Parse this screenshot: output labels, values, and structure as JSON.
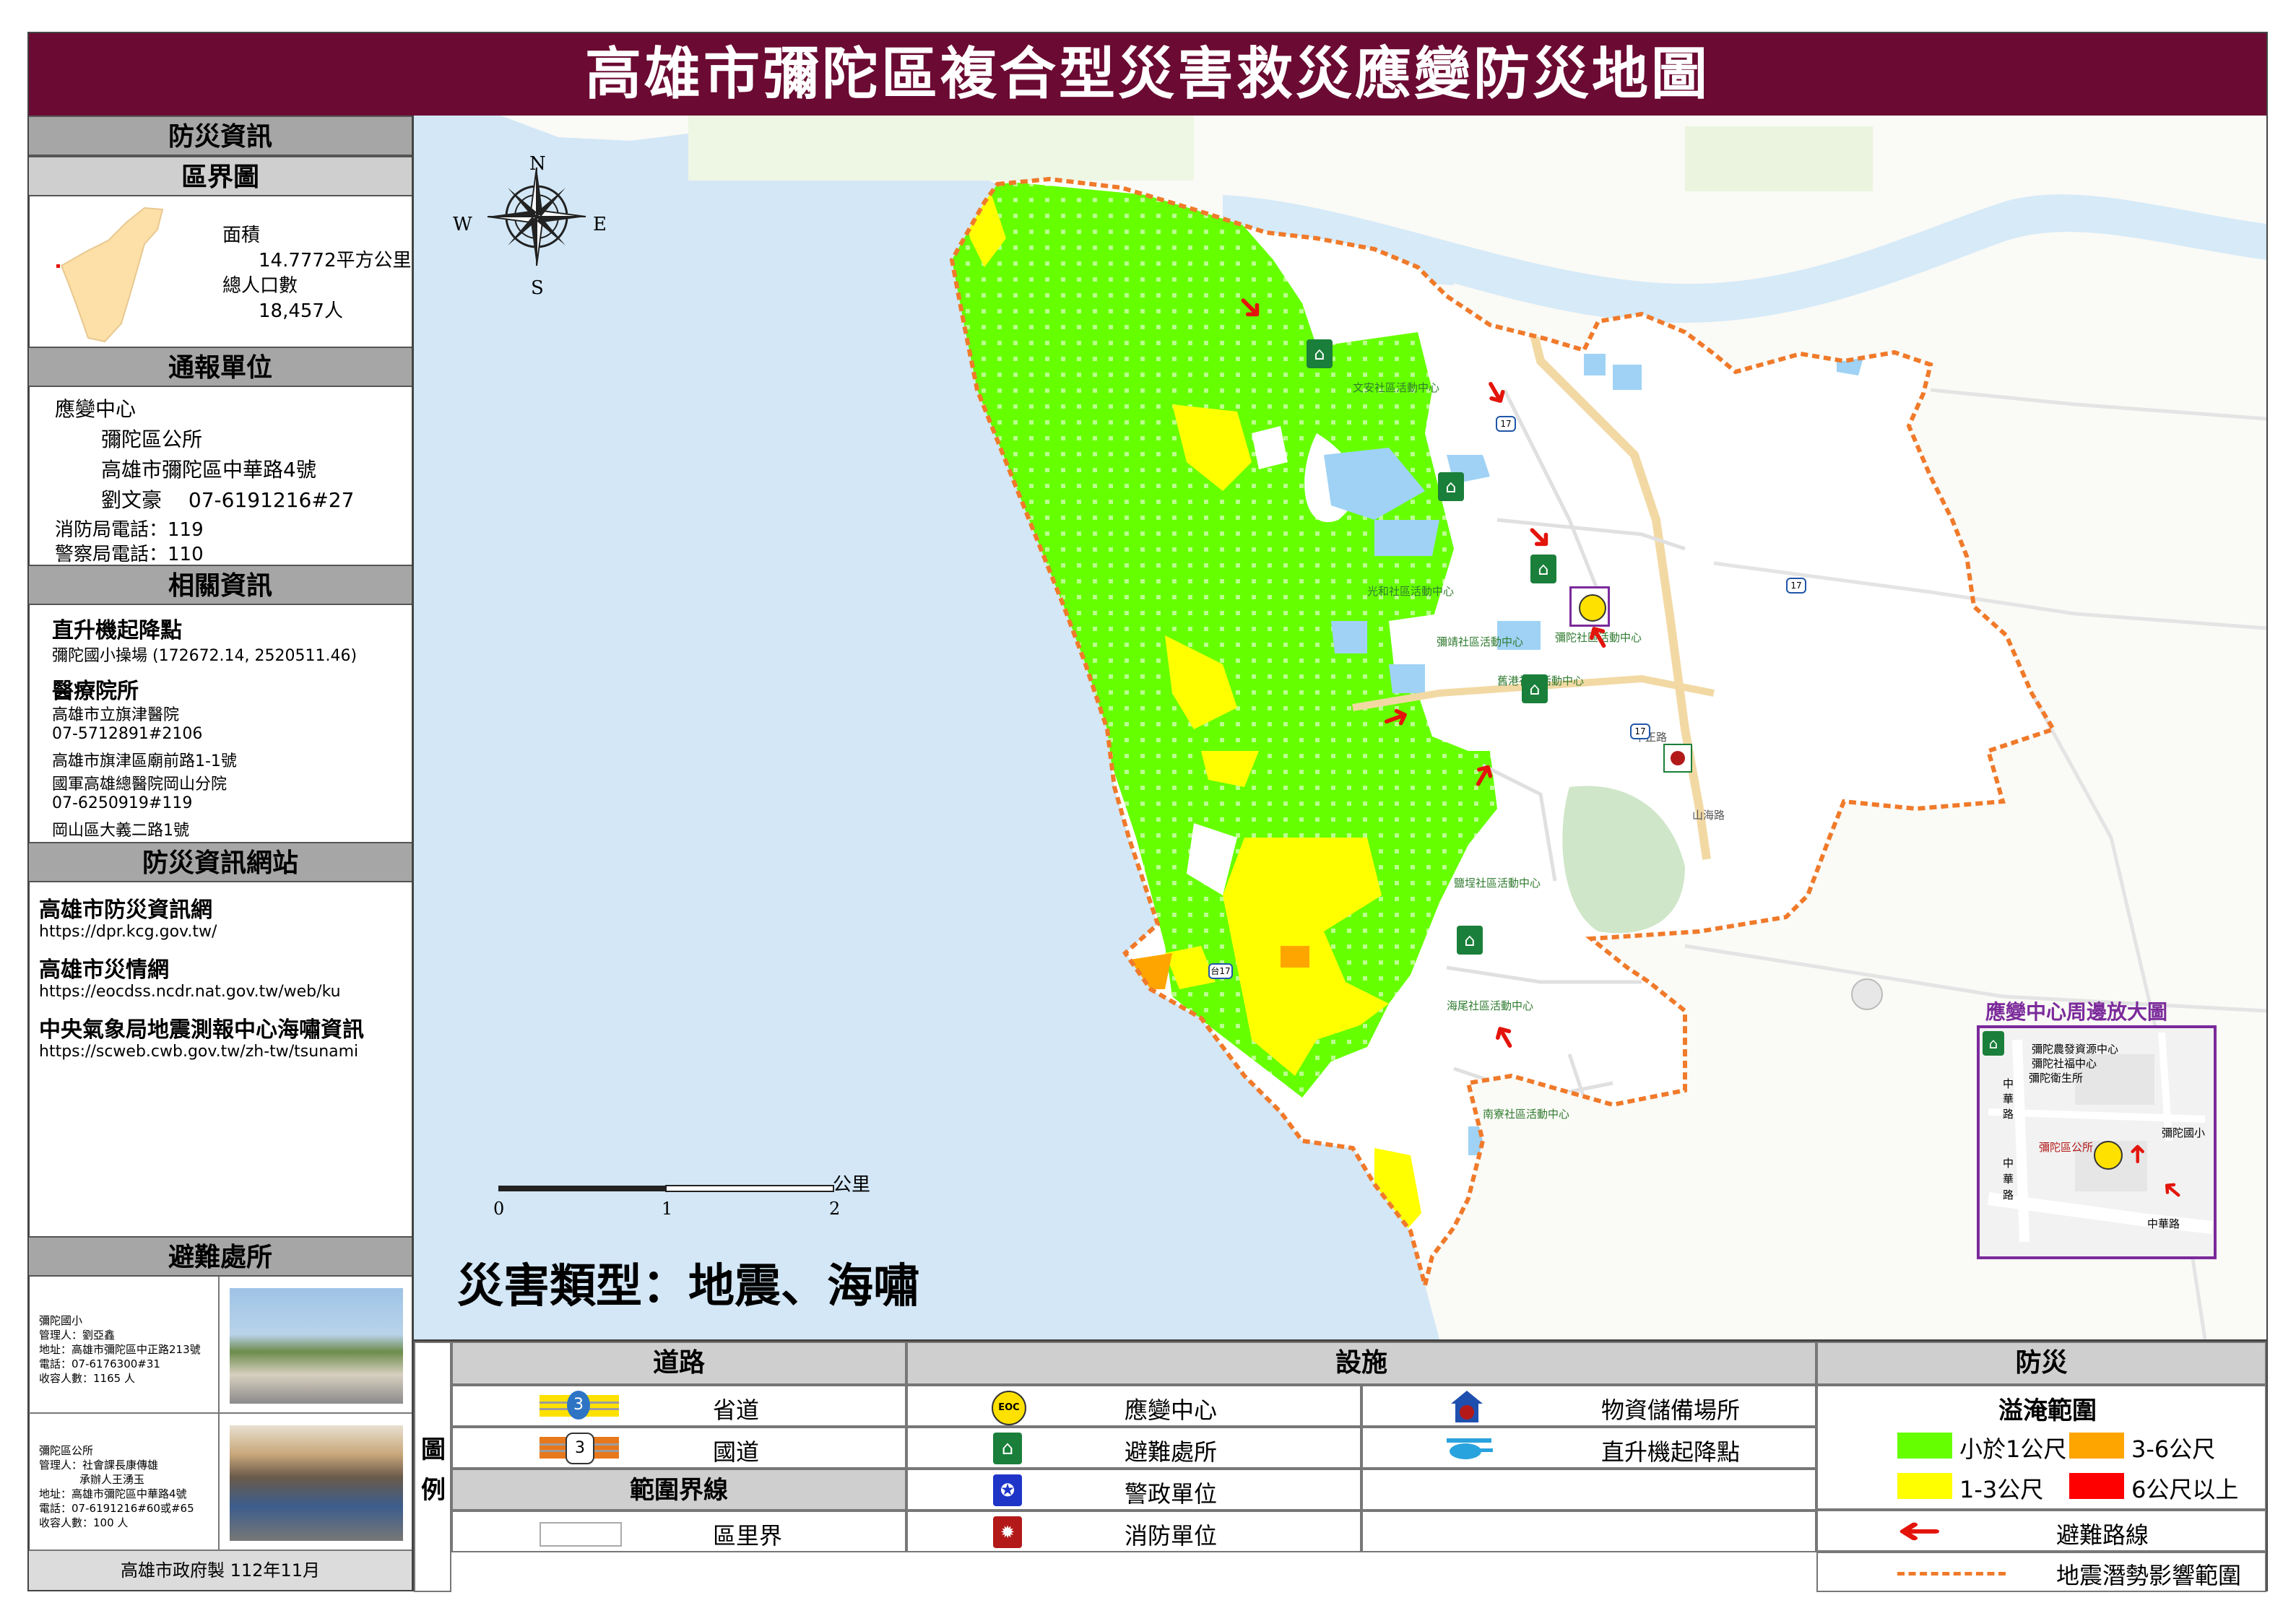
{
  "title": "高雄市彌陀區複合型災害救災應變防災地圖",
  "sidebar": {
    "info_header": "防災資訊",
    "district_header": "區界圖",
    "area_label": "面積",
    "area_value": "14.7772平方公里",
    "pop_label": "總人口數",
    "pop_value": "18,457人",
    "report_header": "通報單位",
    "center_label": "應變中心",
    "center_name": "彌陀區公所",
    "center_address": "高雄市彌陀區中華路4號",
    "center_contact": "劉文豪　 07-6191216#27",
    "fire_phone": "消防局電話：119",
    "police_phone": "警察局電話：110",
    "related_header": "相關資訊",
    "heli_title": "直升機起降點",
    "heli_value": "彌陀國小操場 (172672.14, 2520511.46)",
    "medical_title": "醫療院所",
    "medical_lines": [
      "高雄市立旗津醫院",
      "07-5712891#2106",
      "高雄市旗津區廟前路1-1號",
      "國軍高雄總醫院岡山分院",
      "07-6250919#119",
      "岡山區大義二路1號"
    ],
    "web_header": "防災資訊網站",
    "websites": [
      {
        "name": "高雄市防災資訊網",
        "url": "https://dpr.kcg.gov.tw/"
      },
      {
        "name": "高雄市災情網",
        "url": "https://eocdss.ncdr.nat.gov.tw/web/ku"
      },
      {
        "name": "中央氣象局地震測報中心海嘯資訊",
        "url": "https://scweb.cwb.gov.tw/zh-tw/tsunami"
      }
    ],
    "shelter_header": "避難處所",
    "shelters": [
      {
        "lines": [
          "彌陀國小",
          "管理人：劉亞鑫",
          "地址：高雄市彌陀區中正路213號",
          "電話：07-6176300#31",
          "收容人數：1165 人"
        ]
      },
      {
        "lines": [
          "彌陀區公所",
          "管理人：社會課長康傳雄",
          "承辦人王湧玉",
          "地址：高雄市彌陀區中華路4號",
          "電話：07-6191216#60或#65",
          "收容人數：100 人"
        ]
      }
    ],
    "footer": "高雄市政府製  112年11月"
  },
  "map": {
    "compass": {
      "n": "N",
      "s": "S",
      "e": "E",
      "w": "W"
    },
    "scale": {
      "unit": "公里",
      "ticks": [
        "0",
        "1",
        "2"
      ]
    },
    "disaster_type": "災害類型：地震、海嘯",
    "inset_title": "應變中心周邊放大圖",
    "inset_labels": [
      "彌陀農發資源中心",
      "彌陀社福中心",
      "彌陀衛生所",
      "彌陀區公所",
      "彌陀國小",
      "中華路",
      "中華路",
      "中",
      "華",
      "路"
    ],
    "place_labels": [
      "文安社區活動中心",
      "光和社區活動中心",
      "彌陀社區活動中心",
      "彌靖社區活動中心",
      "舊港社區活動中心",
      "鹽埕社區活動中心",
      "南寮社區活動中心",
      "海尾社區活動中心",
      "中正路",
      "山海路"
    ],
    "road_numbers": [
      "17",
      "17",
      "17",
      "台17"
    ],
    "colors": {
      "flood_lt1": "#66ff00",
      "flood_1_3": "#ffff00",
      "flood_3_6": "#ffa500",
      "flood_gt6": "#ff0000",
      "boundary": "#f07a2a",
      "sea": "#d0e6f5",
      "arrow": "#e3140b"
    }
  },
  "legend": {
    "label": "圖例",
    "road_header": "道路",
    "facility_header": "設施",
    "disaster_header": "防災",
    "provincial": "省道",
    "national": "國道",
    "boundary_header": "範圍界線",
    "village": "區里界",
    "route_num": "3",
    "eoc_icon_text": "EOC",
    "eoc": "應變中心",
    "shelter": "避難處所",
    "police": "警政單位",
    "fire": "消防單位",
    "storage": "物資儲備場所",
    "heli": "直升機起降點",
    "flood_header": "溢淹範圍",
    "lt1": "小於1公尺",
    "d3_6": "3-6公尺",
    "d1_3": "1-3公尺",
    "gt6": "6公尺以上",
    "route": "避難路線",
    "quake": "地震潛勢影響範圍"
  }
}
